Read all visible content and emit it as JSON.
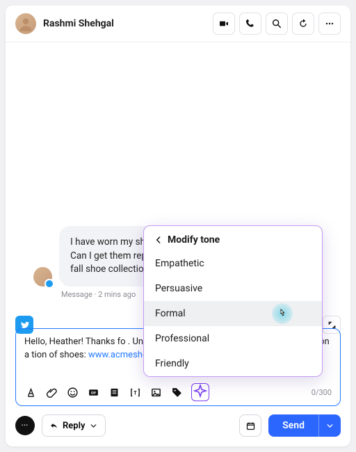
{
  "header": {
    "contact_name": "Rashmi Shehgal"
  },
  "message": {
    "text": "I have worn my shoes out with so many races last year. Can I get them repaired at an ACME Shop? Also, I was  …          fall shoe collectio…          share the link?",
    "meta": "Message · 2 mins ago"
  },
  "composer": {
    "prefix": "Hello, Heather! Thanks fo          . Unfortunately, we can't p             n give you a discount on a             tion of shoes: ",
    "link_text": "www.acmeshoes.com/fallcollection",
    "counter": "0/300"
  },
  "footer": {
    "reply_label": "Reply",
    "send_label": "Send"
  },
  "tone_menu": {
    "title": "Modify tone",
    "options": [
      "Empathetic",
      "Persuasive",
      "Formal",
      "Professional",
      "Friendly"
    ],
    "highlighted_index": 2
  }
}
